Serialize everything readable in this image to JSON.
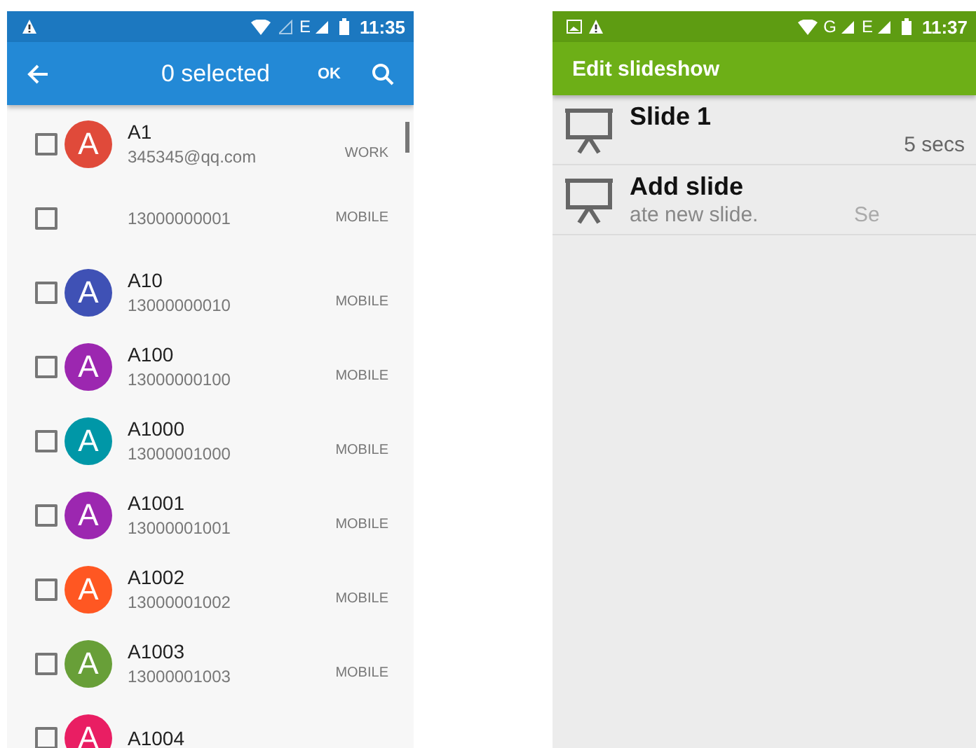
{
  "left_phone": {
    "status_bar": {
      "network": "E",
      "time": "11:35"
    },
    "app_bar": {
      "title": "0 selected",
      "ok": "OK"
    },
    "contacts": [
      {
        "name": "A1",
        "detail": "345345@qq.com",
        "label": "WORK",
        "checked": false,
        "avatar": {
          "letter": "A",
          "color": "#e04a3a"
        }
      },
      {
        "detail": "13000000001",
        "label": "MOBILE",
        "checked": false
      },
      {
        "name": "A10",
        "detail": "13000000010",
        "label": "MOBILE",
        "checked": false,
        "avatar": {
          "letter": "A",
          "color": "#3f51b5"
        }
      },
      {
        "name": "A100",
        "detail": "13000000100",
        "label": "MOBILE",
        "checked": false,
        "avatar": {
          "letter": "A",
          "color": "#9c27b0"
        }
      },
      {
        "name": "A1000",
        "detail": "13000001000",
        "label": "MOBILE",
        "checked": false,
        "avatar": {
          "letter": "A",
          "color": "#0097a7"
        }
      },
      {
        "name": "A1001",
        "detail": "13000001001",
        "label": "MOBILE",
        "checked": false,
        "avatar": {
          "letter": "A",
          "color": "#9c27b0"
        }
      },
      {
        "name": "A1002",
        "detail": "13000001002",
        "label": "MOBILE",
        "checked": false,
        "avatar": {
          "letter": "A",
          "color": "#ff5722"
        }
      },
      {
        "name": "A1003",
        "detail": "13000001003",
        "label": "MOBILE",
        "checked": false,
        "avatar": {
          "letter": "A",
          "color": "#689f38"
        }
      },
      {
        "name": "A1004",
        "checked": false,
        "avatar": {
          "letter": "A",
          "color": "#e91e63"
        }
      }
    ]
  },
  "right_phone": {
    "status_bar": {
      "network_1": "G",
      "network_2": "E",
      "time": "11:37"
    },
    "app_bar": {
      "title": "Edit slideshow"
    },
    "slides": [
      {
        "title": "Slide 1",
        "duration": "5 secs"
      },
      {
        "title": "Add slide",
        "subtitle": "ate new slide.",
        "hint": "Se"
      }
    ]
  }
}
